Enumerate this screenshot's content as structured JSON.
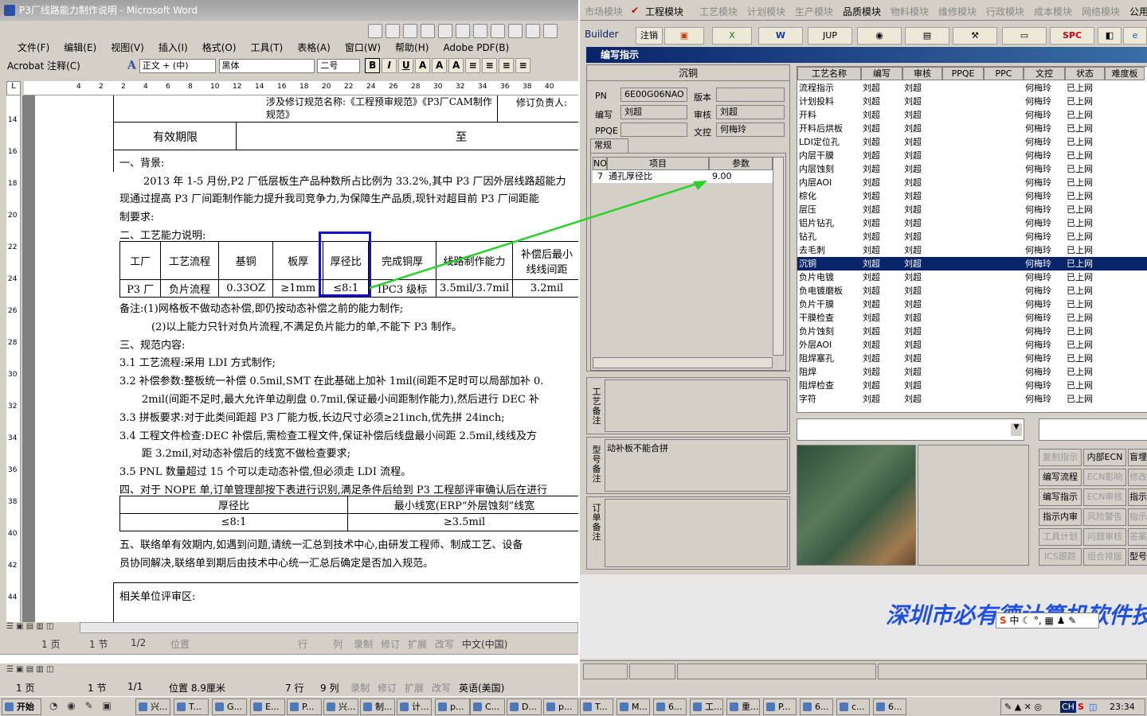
{
  "word": {
    "title": "P3厂线路能力制作说明 - Microsoft Word",
    "menu": [
      "文件(F)",
      "编辑(E)",
      "视图(V)",
      "插入(I)",
      "格式(O)",
      "工具(T)",
      "表格(A)",
      "窗口(W)",
      "帮助(H)",
      "Adobe PDF(B)",
      "Acrobat 注释(C)"
    ],
    "style_combo": "正文 + (中)",
    "font_combo": "黑体",
    "size_combo": "二号",
    "ruler_numbers": [
      "4",
      "2",
      "2",
      "4",
      "6",
      "8",
      "10",
      "12",
      "14",
      "16",
      "18",
      "20",
      "22",
      "24",
      "26",
      "28",
      "30",
      "32",
      "34",
      "36",
      "38",
      "40"
    ],
    "vruler_numbers": [
      "14",
      "16",
      "18",
      "20",
      "22",
      "24",
      "26",
      "28",
      "30",
      "32",
      "34",
      "36",
      "38",
      "40",
      "42",
      "44"
    ],
    "doc": {
      "top_row_text": "涉及修订规范名称:《工程预审规范》《P3厂CAM制作规范》",
      "top_row_right": "修订负责人:",
      "validity_label": "有效期限",
      "validity_to": "至",
      "s1_title": "一、背景:",
      "s1_p1": "2013 年 1-5 月份,P2 厂低层板生产品种数所占比例为 33.2%,其中 P3 厂因外层线路超能力",
      "s1_p2": "现通过提高 P3 厂间距制作能力提升我司竞争力,为保障生产品质,现针对超目前 P3 厂间距能",
      "s1_p3": "制要求:",
      "s2_title": "二、工艺能力说明:",
      "cap_table_head": [
        "工厂",
        "工艺流程",
        "基铜",
        "板厚",
        "厚径比",
        "完成铜厚",
        "线路制作能力",
        "补偿后最小线线间距"
      ],
      "cap_table_row": [
        "P3 厂",
        "负片流程",
        "0.33OZ",
        "≥1mm",
        "≤8:1",
        "IPC3 级标",
        "3.5mil/3.7mil",
        "3.2mil"
      ],
      "note1": "备注:(1)网格板不做动态补偿,即仍按动态补偿之前的能力制作;",
      "note2": "(2)以上能力只针对负片流程,不满足负片能力的单,不能下 P3 制作。",
      "s3_title": "三、规范内容:",
      "s3_1": "3.1 工艺流程:采用 LDI 方式制作;",
      "s3_2a": "3.2 补偿参数:整板统一补偿 0.5mil,SMT 在此基础上加补 1mil(间距不足时可以局部加补 0.",
      "s3_2b": "2mil(间距不足时,最大允许单边削盘 0.7mil,保证最小间距制作能力),然后进行 DEC 补",
      "s3_3": "3.3 拼板要求:对于此类间距超 P3 厂能力板,长边尺寸必须≥21inch,优先拼 24inch;",
      "s3_4a": "3.4 工程文件检查:DEC 补偿后,需检查工程文件,保证补偿后线盘最小间距 2.5mil,线线及方",
      "s3_4b": "距 3.2mil,对动态补偿后的线宽不做检查要求;",
      "s3_5": "3.5 PNL 数量超过 15 个可以走动态补偿,但必须走 LDI 流程。",
      "s4": "四、对于 NOPE 单,订单管理部按下表进行识别,满足条件后给到 P3 工程部评审确认后在进行",
      "t2_head": [
        "厚径比",
        "最小线宽(ERP“外层蚀刻”线宽"
      ],
      "t2_row": [
        "≤8:1",
        "≥3.5mil"
      ],
      "s5a": "五、联络单有效期内,如遇到问题,请统一汇总到技术中心,由研发工程师、制成工艺、设备",
      "s5b": "员协同解决,联络单到期后由技术中心统一汇总后确定是否加入规范。",
      "eval": "相关单位评审区:"
    },
    "status1": {
      "page": "1 页",
      "section": "1 节",
      "pages": "1/2",
      "pos": "位置",
      "line": "行",
      "col": "列",
      "rec": "录制",
      "trk": "修订",
      "ext": "扩展",
      "ovr": "改写",
      "lang": "中文(中国)"
    },
    "status2": {
      "page": "1 页",
      "section": "1 节",
      "pages": "1/1",
      "pos": "位置 8.9厘米",
      "line": "7 行",
      "col": "9 列",
      "rec": "录制",
      "trk": "修订",
      "ext": "扩展",
      "ovr": "改写",
      "lang": "英语(美国)"
    }
  },
  "app": {
    "top_menu": [
      "市场模块",
      "工程模块",
      "工艺模块",
      "计划模块",
      "生产模块",
      "品质模块",
      "物料模块",
      "维修模块",
      "行政模块",
      "成本模块",
      "网络模块",
      "公用"
    ],
    "builder": "Builder",
    "logout": "注销",
    "jup": "JUP",
    "spc": "SPC",
    "dialog_title": "编写指示",
    "process_name": "沉铜",
    "pn_label": "PN",
    "pn_value": "6E00G06NAO",
    "version_label": "版本",
    "version_value": "",
    "writer_label": "编写",
    "writer_value": "刘超",
    "reviewer_label": "审核",
    "reviewer_value": "刘超",
    "ppqe_label": "PPQE",
    "ppqe_value": "",
    "doc_label": "文控",
    "doc_value": "何梅玲",
    "tab_general": "常规",
    "param_head": [
      "NO",
      "项目",
      "参数"
    ],
    "param_row": [
      "7",
      "通孔厚径比",
      "9.00"
    ],
    "remark_process": "工艺备注",
    "remark_model": "型号备注",
    "remark_model_text": "动补板不能合拼",
    "remark_order": "订单备注",
    "grid_head": [
      "工艺名称",
      "编写",
      "审核",
      "PPQE",
      "PPC",
      "文控",
      "状态",
      "难度板"
    ],
    "grid_rows": [
      [
        "流程指示",
        "刘超",
        "刘超",
        "",
        "",
        "何梅玲",
        "已上网"
      ],
      [
        "计划投料",
        "刘超",
        "刘超",
        "",
        "",
        "何梅玲",
        "已上网"
      ],
      [
        "开料",
        "刘超",
        "刘超",
        "",
        "",
        "何梅玲",
        "已上网"
      ],
      [
        "开料后烘板",
        "刘超",
        "刘超",
        "",
        "",
        "何梅玲",
        "已上网"
      ],
      [
        "LDI定位孔",
        "刘超",
        "刘超",
        "",
        "",
        "何梅玲",
        "已上网"
      ],
      [
        "内层干膜",
        "刘超",
        "刘超",
        "",
        "",
        "何梅玲",
        "已上网"
      ],
      [
        "内层蚀刻",
        "刘超",
        "刘超",
        "",
        "",
        "何梅玲",
        "已上网"
      ],
      [
        "内层AOI",
        "刘超",
        "刘超",
        "",
        "",
        "何梅玲",
        "已上网"
      ],
      [
        "棕化",
        "刘超",
        "刘超",
        "",
        "",
        "何梅玲",
        "已上网"
      ],
      [
        "层压",
        "刘超",
        "刘超",
        "",
        "",
        "何梅玲",
        "已上网"
      ],
      [
        "铝片钻孔",
        "刘超",
        "刘超",
        "",
        "",
        "何梅玲",
        "已上网"
      ],
      [
        "钻孔",
        "刘超",
        "刘超",
        "",
        "",
        "何梅玲",
        "已上网"
      ],
      [
        "去毛刺",
        "刘超",
        "刘超",
        "",
        "",
        "何梅玲",
        "已上网"
      ],
      [
        "沉铜",
        "刘超",
        "刘超",
        "",
        "",
        "何梅玲",
        "已上网"
      ],
      [
        "负片电镀",
        "刘超",
        "刘超",
        "",
        "",
        "何梅玲",
        "已上网"
      ],
      [
        "负电镀磨板",
        "刘超",
        "刘超",
        "",
        "",
        "何梅玲",
        "已上网"
      ],
      [
        "负片干膜",
        "刘超",
        "刘超",
        "",
        "",
        "何梅玲",
        "已上网"
      ],
      [
        "干膜检查",
        "刘超",
        "刘超",
        "",
        "",
        "何梅玲",
        "已上网"
      ],
      [
        "负片蚀刻",
        "刘超",
        "刘超",
        "",
        "",
        "何梅玲",
        "已上网"
      ],
      [
        "外层AOI",
        "刘超",
        "刘超",
        "",
        "",
        "何梅玲",
        "已上网"
      ],
      [
        "阻焊塞孔",
        "刘超",
        "刘超",
        "",
        "",
        "何梅玲",
        "已上网"
      ],
      [
        "阻焊",
        "刘超",
        "刘超",
        "",
        "",
        "何梅玲",
        "已上网"
      ],
      [
        "阻焊检查",
        "刘超",
        "刘超",
        "",
        "",
        "何梅玲",
        "已上网"
      ],
      [
        "字符",
        "刘超",
        "刘超",
        "",
        "",
        "何梅玲",
        "已上网"
      ]
    ],
    "selected_row": 13,
    "buttons": [
      {
        "label": "复制指示",
        "enabled": false
      },
      {
        "label": "内部ECN",
        "enabled": true
      },
      {
        "label": "盲埋",
        "enabled": true
      },
      {
        "label": "编写流程",
        "enabled": true
      },
      {
        "label": "ECN影响",
        "enabled": false
      },
      {
        "label": "修改",
        "enabled": false
      },
      {
        "label": "编写指示",
        "enabled": true
      },
      {
        "label": "ECN审核",
        "enabled": false
      },
      {
        "label": "指示",
        "enabled": true
      },
      {
        "label": "指示内审",
        "enabled": true
      },
      {
        "label": "风险警告",
        "enabled": false
      },
      {
        "label": "指示",
        "enabled": false
      },
      {
        "label": "工具计划",
        "enabled": false
      },
      {
        "label": "问题审核",
        "enabled": false
      },
      {
        "label": "答案",
        "enabled": false
      },
      {
        "label": "ICS跟踪",
        "enabled": false
      },
      {
        "label": "组合排版",
        "enabled": false
      },
      {
        "label": "型号",
        "enabled": true
      }
    ],
    "company_banner": "深圳市必有德计算机软件技术",
    "ime_text": "中"
  },
  "taskbar": {
    "start": "开始",
    "tasks_left": [
      "兴...",
      "T...",
      "G...",
      "E...",
      "P...",
      "兴...",
      "制...",
      "计...",
      "p...",
      "C...",
      "D...",
      "p..."
    ],
    "tasks_right": [
      "T...",
      "M...",
      "6...",
      "工...",
      "重...",
      "P...",
      "6...",
      "c...",
      "6..."
    ],
    "clock": "23:34",
    "tray_lang": "CH"
  },
  "colors": {
    "selection": "#0a246a",
    "annotation_box": "#1010d0",
    "arrow": "#2bd12b",
    "banner": "#2050e0"
  }
}
